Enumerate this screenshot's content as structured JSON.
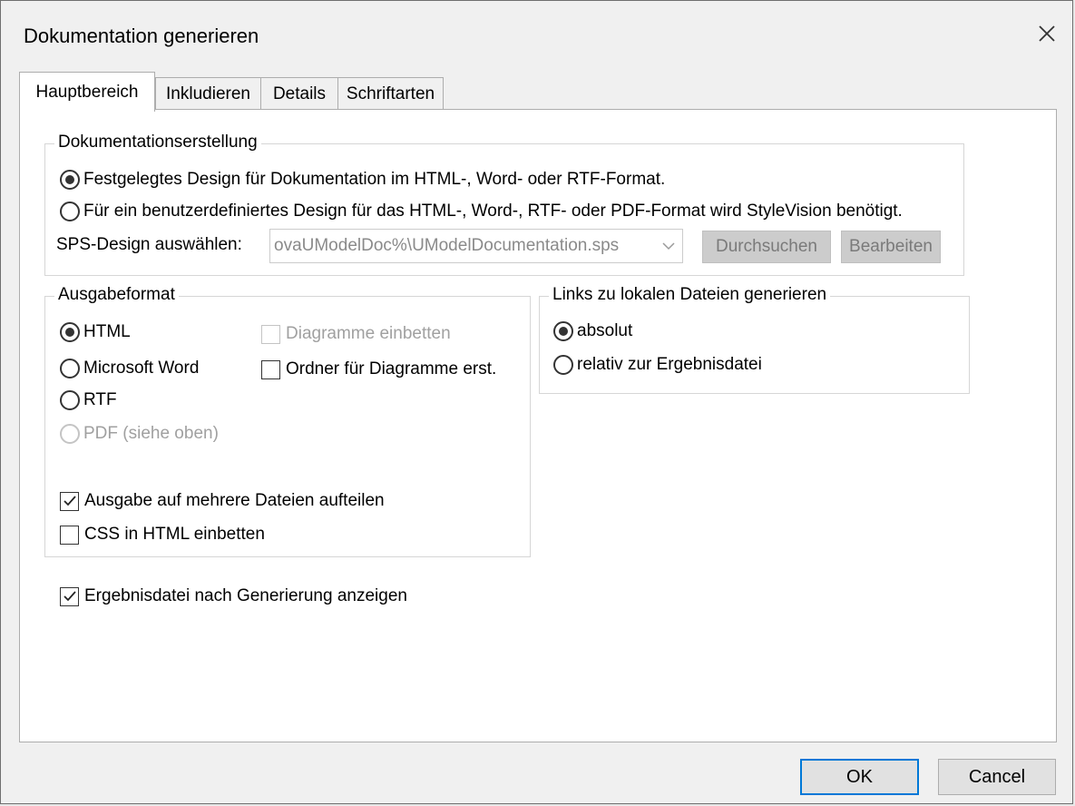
{
  "window": {
    "title": "Dokumentation generieren"
  },
  "icons": {
    "close": "close-icon",
    "dropdown": "chevron-down-icon",
    "check": "checkmark-icon"
  },
  "tabs": [
    "Hauptbereich",
    "Inkludieren",
    "Details",
    "Schriftarten"
  ],
  "active_tab": "Hauptbereich",
  "doc_creation": {
    "legend": "Dokumentationserstellung",
    "option_fixed": "Festgelegtes Design für Dokumentation im HTML-, Word- oder RTF-Format.",
    "option_custom": "Für ein benutzerdefiniertes Design für das HTML-, Word-, RTF- oder PDF-Format wird StyleVision benötigt.",
    "sps_label": "SPS-Design auswählen:",
    "sps_value": "ovaUModelDoc%\\UModelDocumentation.sps",
    "browse_label": "Durchsuchen",
    "edit_label": "Bearbeiten",
    "selected": "fixed"
  },
  "output_format": {
    "legend": "Ausgabeformat",
    "html": "HTML",
    "word": "Microsoft Word",
    "rtf": "RTF",
    "pdf": "PDF (siehe oben)",
    "selected": "html",
    "embed_diagrams": "Diagramme einbetten",
    "embed_diagrams_checked": false,
    "create_folder": "Ordner für Diagramme erst.",
    "create_folder_checked": false,
    "split_output": "Ausgabe auf mehrere Dateien aufteilen",
    "split_output_checked": true,
    "embed_css": "CSS in HTML einbetten",
    "embed_css_checked": false
  },
  "links": {
    "legend": "Links zu lokalen Dateien generieren",
    "absolute": "absolut",
    "relative": "relativ zur Ergebnisdatei",
    "selected": "absolute"
  },
  "show_result": {
    "label": "Ergebnisdatei nach Generierung anzeigen",
    "checked": true
  },
  "buttons": {
    "ok": "OK",
    "cancel": "Cancel"
  }
}
